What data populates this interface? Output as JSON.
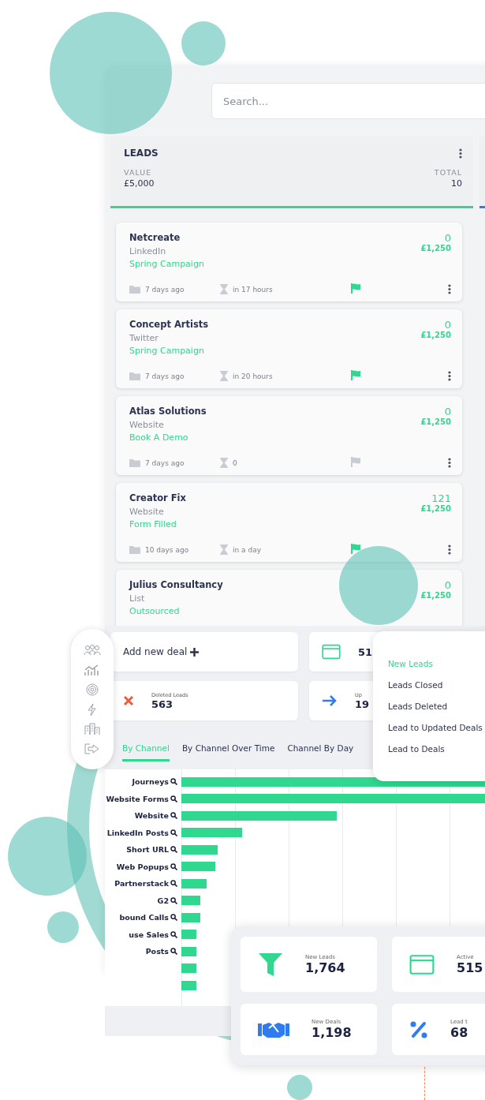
{
  "search": {
    "placeholder": "Search..."
  },
  "leads_column": {
    "title": "LEADS",
    "value_label": "VALUE",
    "value": "£5,000",
    "total_label": "TOTAL",
    "total": "10"
  },
  "deals": [
    {
      "name": "Netcreate",
      "source": "LinkedIn",
      "campaign": "Spring Campaign",
      "count": "0",
      "amount": "£1,250",
      "created": "7 days ago",
      "due": "in 17 hours",
      "flagged": true
    },
    {
      "name": "Concept Artists",
      "source": "Twitter",
      "campaign": "Spring Campaign",
      "count": "0",
      "amount": "£1,250",
      "created": "7 days ago",
      "due": "in 20 hours",
      "flagged": true
    },
    {
      "name": "Atlas Solutions",
      "source": "Website",
      "campaign": "Book A Demo",
      "count": "0",
      "amount": "£1,250",
      "created": "7 days ago",
      "due": "0",
      "flagged": false
    },
    {
      "name": "Creator Fix",
      "source": "Website",
      "campaign": "Form Filled",
      "count": "121",
      "amount": "£1,250",
      "created": "10 days ago",
      "due": "in a day",
      "flagged": true
    },
    {
      "name": "Julius Consultancy",
      "source": "List",
      "campaign": "Outsourced",
      "count": "0",
      "amount": "£1,250"
    }
  ],
  "add_deal": {
    "label": "Add new deal"
  },
  "tiles": [
    {
      "kind": "browser",
      "value": "51"
    },
    {
      "kind": "deleted",
      "label": "Deleted Leads",
      "value": "563"
    },
    {
      "kind": "arrow",
      "label": "Up",
      "value": "19"
    }
  ],
  "tabs": [
    {
      "label": "By Channel",
      "selected": true
    },
    {
      "label": "By Channel Over Time",
      "selected": false
    },
    {
      "label": "Channel By Day",
      "selected": false
    }
  ],
  "channels": [
    {
      "label": "Journeys"
    },
    {
      "label": "Website Forms"
    },
    {
      "label": "Website"
    },
    {
      "label": "LinkedIn Posts"
    },
    {
      "label": "Short URL"
    },
    {
      "label": "Web Popups"
    },
    {
      "label": "Partnerstack"
    },
    {
      "label": "G2"
    },
    {
      "label": "bound Calls"
    },
    {
      "label": "use Sales"
    },
    {
      "label": "Posts"
    }
  ],
  "menu": [
    {
      "label": "New Leads",
      "selected": true
    },
    {
      "label": "Leads Closed",
      "selected": false
    },
    {
      "label": "Leads Deleted",
      "selected": false
    },
    {
      "label": "Lead to Updated Deals",
      "selected": false
    },
    {
      "label": "Lead to Deals",
      "selected": false
    }
  ],
  "sidebar": [
    {
      "kind": "people"
    },
    {
      "kind": "chart"
    },
    {
      "kind": "target"
    },
    {
      "kind": "bolt"
    },
    {
      "kind": "buildings"
    },
    {
      "kind": "exit"
    }
  ],
  "stats": [
    {
      "kind": "funnel",
      "label": "New Leads",
      "value": "1,764"
    },
    {
      "kind": "browser",
      "label": "Active",
      "value": "515"
    },
    {
      "kind": "handshake",
      "label": "New Deals",
      "value": "1,198"
    },
    {
      "kind": "percent",
      "label": "Lead t",
      "value": "68"
    }
  ]
}
